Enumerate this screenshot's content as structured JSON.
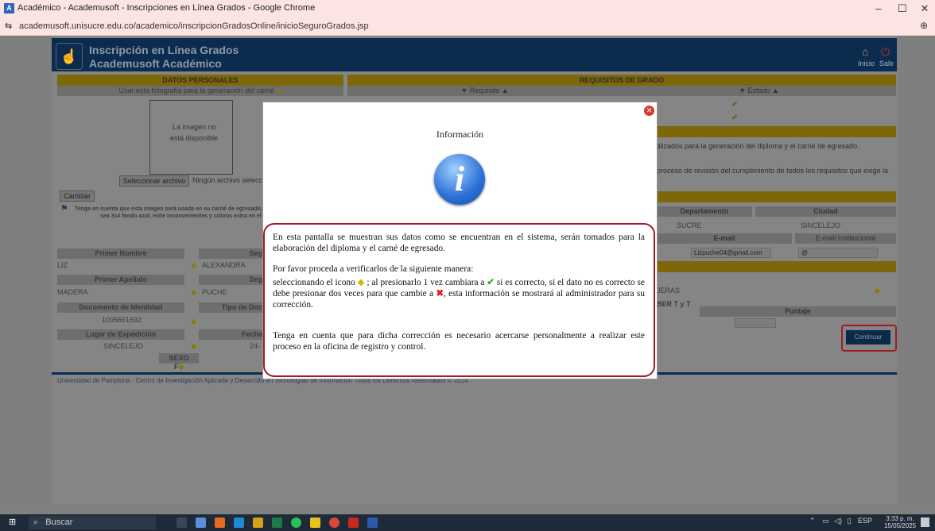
{
  "browser": {
    "window_title": "Académico - Academusoft - Inscripciones en Línea Grados - Google Chrome",
    "url": "academusoft.unisucre.edu.co/academico/inscripcionGradosOnline/inicioSeguroGrados.jsp"
  },
  "header": {
    "line1": "Inscripción en Línea Grados",
    "line2": "Academusoft Académico",
    "nav_inicio": "Inicio",
    "nav_salir": "Salir"
  },
  "left": {
    "section_title": "DATOS PERSONALES",
    "photo_caption": "Usar esta fotografía para la generación del carné",
    "photo_missing_1": "La imagen no",
    "photo_missing_2": "está disponible",
    "file_button": "Seleccionar archivo",
    "file_status": "Ningún archivo selecc",
    "change_button": "Cambiar",
    "note_1": "Tenga en cuenta que esta imagen será usada en su carné de egresado, por",
    "note_2": "sea 3x4 fondo azul, evite inconvenientes y cobros extra en el du",
    "primer_nombre_label": "Primer Nombre",
    "segundo_nombre_label": "Seg",
    "primer_nombre": "LIZ",
    "segundo_nombre": "ALEXANDRA",
    "primer_apellido_label": "Primer Apellido",
    "segundo_apellido_label": "Seg",
    "primer_apellido": "MADERA",
    "segundo_apellido": "PUCHE",
    "documento_label": "Documento de Identidad",
    "tipo_doc_label": "Tipo de Doc",
    "documento": "1005661692",
    "lugar_label": "Lugar de Expedición",
    "fecha_label": "Fecha",
    "lugar": "SINCELEJO",
    "fecha": "24-",
    "sexo_label": "SEXO",
    "sexo": "F"
  },
  "right": {
    "section_title": "REQUISITOS DE GRADO",
    "col_requisito": "▼ Requisito ▲",
    "col_estado": "▼ Estado ▲",
    "info_1": "tilizados para la generación del diploma y el carné de egresado.",
    "info_2": "proceso de revisión del cumplimiento de todos los requisitos que exige la",
    "departamento_label": "Departamento",
    "ciudad_label": "Ciudad",
    "departamento": "SUCRE",
    "ciudad": "SINCELEJO",
    "email_label": "E-mail",
    "email_inst_label": "E-mail Institucional",
    "email": "Lizpuche04@gmail.com",
    "email_inst": "@",
    "partial_1": "JERAS",
    "partial_2": "BER T y T",
    "puntaje_label": "Puntaje",
    "continue_button": "Continuar"
  },
  "footer": "Universidad de Pamplona - Centro de Investigación Aplicada y Desarrollo en Tecnologías de Información Todos los Derechos Reservados © 2014",
  "modal": {
    "title": "Información",
    "p1": "En esta pantalla se muestran sus datos como se encuentran en el sistema, serán tomados para la elaboración del diploma y el carné de egresado.",
    "p2a": "Por favor proceda a verificarlos de la siguiente manera:",
    "p2b_1": "seleccionando el icono",
    "p2b_2": "; al presionarlo 1 vez cambiara a",
    "p2b_3": "si es correcto, si el dato no es correcto se debe presionar dos veces para que cambie a",
    "p2b_4": ", esta información se mostrará al administrador para su corrección.",
    "p3": "Tenga en cuenta que para dicha corrección es necesario acercarse personalmente a realizar este proceso en la oficina de registro y control."
  },
  "taskbar": {
    "search_placeholder": "Buscar",
    "lang": "ESP",
    "time": "3:33 p. m.",
    "date": "15/05/2025"
  },
  "colors": {
    "modal_border_highlight": "#a01c24",
    "header_bg": "#0b2c4f"
  }
}
